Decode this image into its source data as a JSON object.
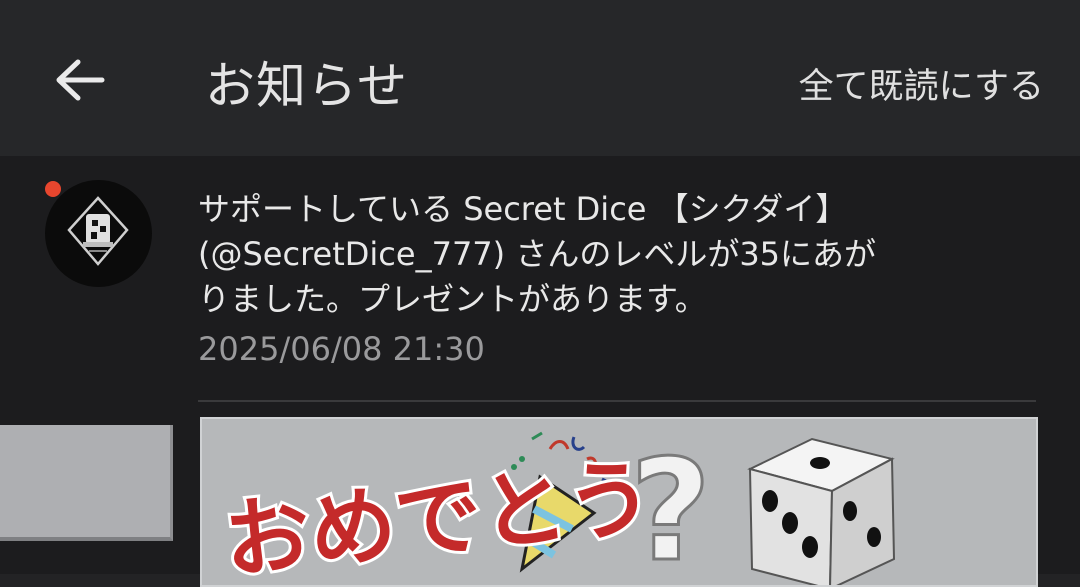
{
  "header": {
    "back_icon": "arrow-left-icon",
    "title": "お知らせ",
    "mark_all_read": "全て既読にする"
  },
  "notification": {
    "unread": true,
    "unread_color": "#e8462e",
    "avatar_icon": "secret-dice-avatar",
    "message_lines": [
      "サポートしている Secret Dice 【シクダイ】",
      "(@SecretDice_777) さんのレベルが35にあが",
      "りました。プレゼントがあります。"
    ],
    "timestamp": "2025/06/08 21:30",
    "banner_text": "おめでとう"
  }
}
